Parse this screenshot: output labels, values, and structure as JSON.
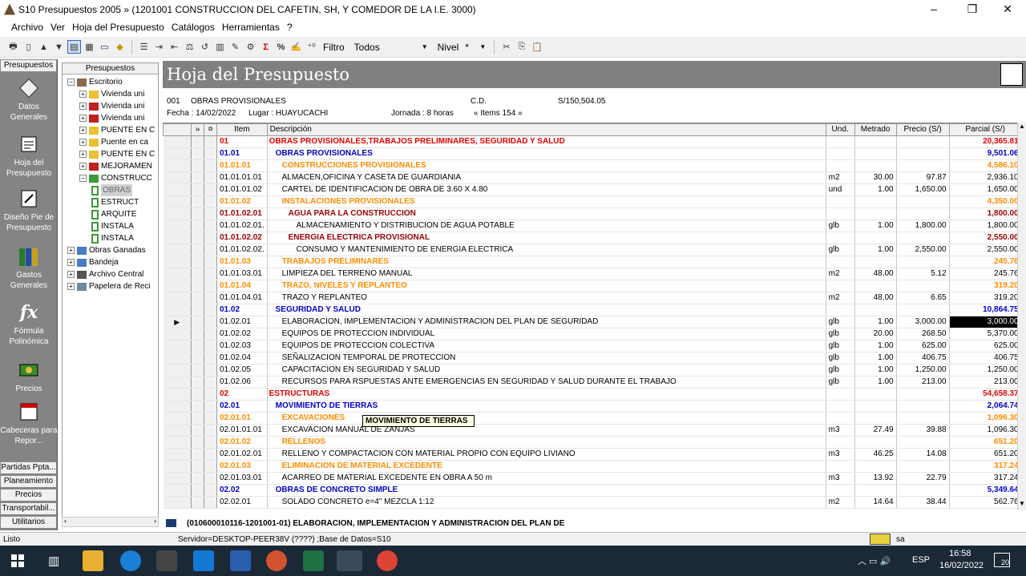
{
  "window": {
    "title": "S10 Presupuestos 2005 » (1201001 CONSTRUCCION DEL CAFETIN, SH, Y COMEDOR DE LA I.E. 3000)",
    "minimize": "–",
    "maximize": "❐",
    "close": "✕"
  },
  "menu": [
    "Archivo",
    "Ver",
    "Hoja del Presupuesto",
    "Catálogos",
    "Herramientas",
    "?"
  ],
  "toolbar": {
    "filtro_label": "Filtro",
    "filtro_value": "Todos",
    "nivel_label": "Nivel",
    "nivel_value": "*"
  },
  "left_tabs": {
    "top": "Presupuestos",
    "bottom": [
      "Partidas Ppta...",
      "Planeamiento",
      "Precios",
      "Transportabil...",
      "Utilitarios"
    ]
  },
  "left_buttons": [
    "Datos Generales",
    "Hoja del Presupuesto",
    "Diseño Pie de Presupuesto",
    "Gastos Generales",
    "Fórmula Polinómica",
    "Precios",
    "Cabeceras para Repor..."
  ],
  "tree": {
    "header": "Presupuestos",
    "nodes": [
      {
        "label": "Escritorio",
        "indent": 0,
        "pm": "−",
        "icon": "desk"
      },
      {
        "label": "Vivienda uni",
        "indent": 1,
        "pm": "+",
        "icon": "yellow"
      },
      {
        "label": "Vivienda uni",
        "indent": 1,
        "pm": "+",
        "icon": "red"
      },
      {
        "label": "Vivienda uni",
        "indent": 1,
        "pm": "+",
        "icon": "red"
      },
      {
        "label": "PUENTE EN C",
        "indent": 1,
        "pm": "+",
        "icon": "yellow"
      },
      {
        "label": "Puente en ca",
        "indent": 1,
        "pm": "+",
        "icon": "yellow"
      },
      {
        "label": "PUENTE EN C",
        "indent": 1,
        "pm": "+",
        "icon": "yellow"
      },
      {
        "label": "MEJORAMEN",
        "indent": 1,
        "pm": "+",
        "icon": "red"
      },
      {
        "label": "CONSTRUCC",
        "indent": 1,
        "pm": "−",
        "icon": "green"
      },
      {
        "label": "OBRAS",
        "indent": 2,
        "pm": "",
        "icon": "doc",
        "selected": true
      },
      {
        "label": "ESTRUCT",
        "indent": 2,
        "pm": "",
        "icon": "doc"
      },
      {
        "label": "ARQUITE",
        "indent": 2,
        "pm": "",
        "icon": "doc"
      },
      {
        "label": "INSTALA",
        "indent": 2,
        "pm": "",
        "icon": "doc"
      },
      {
        "label": "INSTALA",
        "indent": 2,
        "pm": "",
        "icon": "doc"
      },
      {
        "label": "Obras Ganadas",
        "indent": 0,
        "pm": "+",
        "icon": "people"
      },
      {
        "label": "Bandeja",
        "indent": 0,
        "pm": "+",
        "icon": "people"
      },
      {
        "label": "Archivo Central",
        "indent": 0,
        "pm": "+",
        "icon": "cabinet"
      },
      {
        "label": "Papelera de Reci",
        "indent": 0,
        "pm": "+",
        "icon": "bin"
      }
    ]
  },
  "sheet": {
    "banner": "Hoja del Presupuesto",
    "info_code": "001",
    "info_name": "OBRAS PROVISIONALES",
    "info_cd": "C.D.",
    "info_total": "S/150,504.05",
    "info_fecha": "Fecha : 14/02/2022",
    "info_lugar": "Lugar :  HUAYUCACHI",
    "info_jornada": "Jornada :  8   horas",
    "info_items": "« Items 154 »"
  },
  "columns": [
    "»",
    "¤",
    "Item",
    "Descripción",
    "Und.",
    "Metrado",
    "Precio (S/)",
    "Parcial (S/)"
  ],
  "rows": [
    {
      "item": "01",
      "desc": "OBRAS PROVISIONALES,TRABAJOS PRELIMINARES, SEGURIDAD Y SALUD",
      "und": "",
      "metrado": "",
      "precio": "",
      "parcial": "20,365.81",
      "lvl": "lv1"
    },
    {
      "item": "01.01",
      "desc": "OBRAS PROVISIONALES",
      "und": "",
      "metrado": "",
      "precio": "",
      "parcial": "9,501.06",
      "lvl": "lv2"
    },
    {
      "item": "01.01.01",
      "desc": "CONSTRUCCIONES PROVISIONALES",
      "und": "",
      "metrado": "",
      "precio": "",
      "parcial": "4,586.10",
      "lvl": "lv3"
    },
    {
      "item": "01.01.01.01",
      "desc": "ALMACEN,OFICINA Y CASETA DE GUARDIANIA",
      "und": "m2",
      "metrado": "30.00",
      "precio": "97.87",
      "parcial": "2,936.10",
      "lvl": ""
    },
    {
      "item": "01.01.01.02",
      "desc": "CARTEL DE IDENTIFICACION DE OBRA DE 3.60 X 4.80",
      "und": "und",
      "metrado": "1.00",
      "precio": "1,650.00",
      "parcial": "1,650.00",
      "lvl": ""
    },
    {
      "item": "01.01.02",
      "desc": "INSTALACIONES PROVISIONALES",
      "und": "",
      "metrado": "",
      "precio": "",
      "parcial": "4,350.00",
      "lvl": "lv3"
    },
    {
      "item": "01.01.02.01",
      "desc": "AGUA PARA LA CONSTRUCCION",
      "und": "",
      "metrado": "",
      "precio": "",
      "parcial": "1,800.00",
      "lvl": "lv4"
    },
    {
      "item": "01.01.02.01.",
      "desc": "ALMACENAMIENTO Y DISTRIBUCION DE AGUA POTABLE",
      "und": "glb",
      "metrado": "1.00",
      "precio": "1,800.00",
      "parcial": "1,800.00",
      "lvl": ""
    },
    {
      "item": "01.01.02.02",
      "desc": "ENERGIA ELECTRICA PROVISIONAL",
      "und": "",
      "metrado": "",
      "precio": "",
      "parcial": "2,550.00",
      "lvl": "lv4"
    },
    {
      "item": "01.01.02.02.",
      "desc": "CONSUMO Y MANTENIMIENTO DE ENERGIA ELECTRICA",
      "und": "glb",
      "metrado": "1.00",
      "precio": "2,550.00",
      "parcial": "2,550.00",
      "lvl": ""
    },
    {
      "item": "01.01.03",
      "desc": "TRABAJOS PRELIMINARES",
      "und": "",
      "metrado": "",
      "precio": "",
      "parcial": "245.76",
      "lvl": "lv3"
    },
    {
      "item": "01.01.03.01",
      "desc": "LIMPIEZA DEL TERRENO MANUAL",
      "und": "m2",
      "metrado": "48.00",
      "precio": "5.12",
      "parcial": "245.76",
      "lvl": ""
    },
    {
      "item": "01.01.04",
      "desc": "TRAZO, NIVELES Y REPLANTEO",
      "und": "",
      "metrado": "",
      "precio": "",
      "parcial": "319.20",
      "lvl": "lv3"
    },
    {
      "item": "01.01.04.01",
      "desc": "TRAZO Y REPLANTEO",
      "und": "m2",
      "metrado": "48.00",
      "precio": "6.65",
      "parcial": "319.20",
      "lvl": ""
    },
    {
      "item": "01.02",
      "desc": "SEGURIDAD Y SALUD",
      "und": "",
      "metrado": "",
      "precio": "",
      "parcial": "10,864.75",
      "lvl": "lv2"
    },
    {
      "item": "01.02.01",
      "desc": "ELABORACION, IMPLEMENTACION Y ADMINISTRACION DEL PLAN DE SEGURIDAD",
      "und": "glb",
      "metrado": "1.00",
      "precio": "3,000.00",
      "parcial": "3,000.00",
      "lvl": "",
      "current": true
    },
    {
      "item": "01.02.02",
      "desc": "EQUIPOS DE PROTECCION INDIVIDUAL",
      "und": "glb",
      "metrado": "20.00",
      "precio": "268.50",
      "parcial": "5,370.00",
      "lvl": ""
    },
    {
      "item": "01.02.03",
      "desc": "EQUIPOS DE PROTECCION COLECTIVA",
      "und": "glb",
      "metrado": "1.00",
      "precio": "625.00",
      "parcial": "625.00",
      "lvl": ""
    },
    {
      "item": "01.02.04",
      "desc": "SEÑALIZACION TEMPORAL DE PROTECCION",
      "und": "glb",
      "metrado": "1.00",
      "precio": "406.75",
      "parcial": "406.75",
      "lvl": ""
    },
    {
      "item": "01.02.05",
      "desc": "CAPACITACION EN SEGURIDAD Y SALUD",
      "und": "glb",
      "metrado": "1.00",
      "precio": "1,250.00",
      "parcial": "1,250.00",
      "lvl": ""
    },
    {
      "item": "01.02.06",
      "desc": "RECURSOS PARA RSPUESTAS ANTE EMERGENCIAS EN SEGURIDAD Y SALUD DURANTE EL TRABAJO",
      "und": "glb",
      "metrado": "1.00",
      "precio": "213.00",
      "parcial": "213.00",
      "lvl": ""
    },
    {
      "item": "02",
      "desc": "ESTRUCTURAS",
      "und": "",
      "metrado": "",
      "precio": "",
      "parcial": "54,658.37",
      "lvl": "lv1"
    },
    {
      "item": "02.01",
      "desc": "MOVIMIENTO DE TIERRAS",
      "und": "",
      "metrado": "",
      "precio": "",
      "parcial": "2,064.74",
      "lvl": "lv2"
    },
    {
      "item": "02.01.01",
      "desc": "EXCAVACIONES",
      "und": "",
      "metrado": "",
      "precio": "",
      "parcial": "1,096.30",
      "lvl": "lv3"
    },
    {
      "item": "02.01.01.01",
      "desc": "EXCAVACION MANUAL DE ZANJAS",
      "und": "m3",
      "metrado": "27.49",
      "precio": "39.88",
      "parcial": "1,096.30",
      "lvl": ""
    },
    {
      "item": "02.01.02",
      "desc": "RELLENOS",
      "und": "",
      "metrado": "",
      "precio": "",
      "parcial": "651.20",
      "lvl": "lv3"
    },
    {
      "item": "02.01.02.01",
      "desc": "RELLENO Y COMPACTACION CON MATERIAL PROPIO CON EQUIPO LIVIANO",
      "und": "m3",
      "metrado": "46.25",
      "precio": "14.08",
      "parcial": "651.20",
      "lvl": ""
    },
    {
      "item": "02.01.03",
      "desc": "ELIMINACION DE MATERIAL EXCEDENTE",
      "und": "",
      "metrado": "",
      "precio": "",
      "parcial": "317.24",
      "lvl": "lv3"
    },
    {
      "item": "02.01.03.01",
      "desc": "ACARREO DE MATERIAL EXCEDENTE EN OBRA A 50 m",
      "und": "m3",
      "metrado": "13.92",
      "precio": "22.79",
      "parcial": "317.24",
      "lvl": ""
    },
    {
      "item": "02.02",
      "desc": "OBRAS DE CONCRETO SIMPLE",
      "und": "",
      "metrado": "",
      "precio": "",
      "parcial": "5,349.64",
      "lvl": "lv2"
    },
    {
      "item": "02.02.01",
      "desc": "SOLADO CONCRETO e=4\" MEZCLA 1:12",
      "und": "m2",
      "metrado": "14.64",
      "precio": "38.44",
      "parcial": "562.76",
      "lvl": ""
    }
  ],
  "tooltip": "MOVIMIENTO DE TIERRAS",
  "status_desc": "(010600010116-1201001-01) ELABORACION, IMPLEMENTACION Y ADMINISTRACION DEL PLAN DE",
  "statusbar": {
    "left": "Listo",
    "server": "Servidor=DESKTOP-PEER38V (????) ;Base de Datos=S10",
    "user": "sa"
  },
  "taskbar": {
    "lang": "ESP",
    "time": "16:58",
    "date": "16/02/2022",
    "notif": "20"
  }
}
